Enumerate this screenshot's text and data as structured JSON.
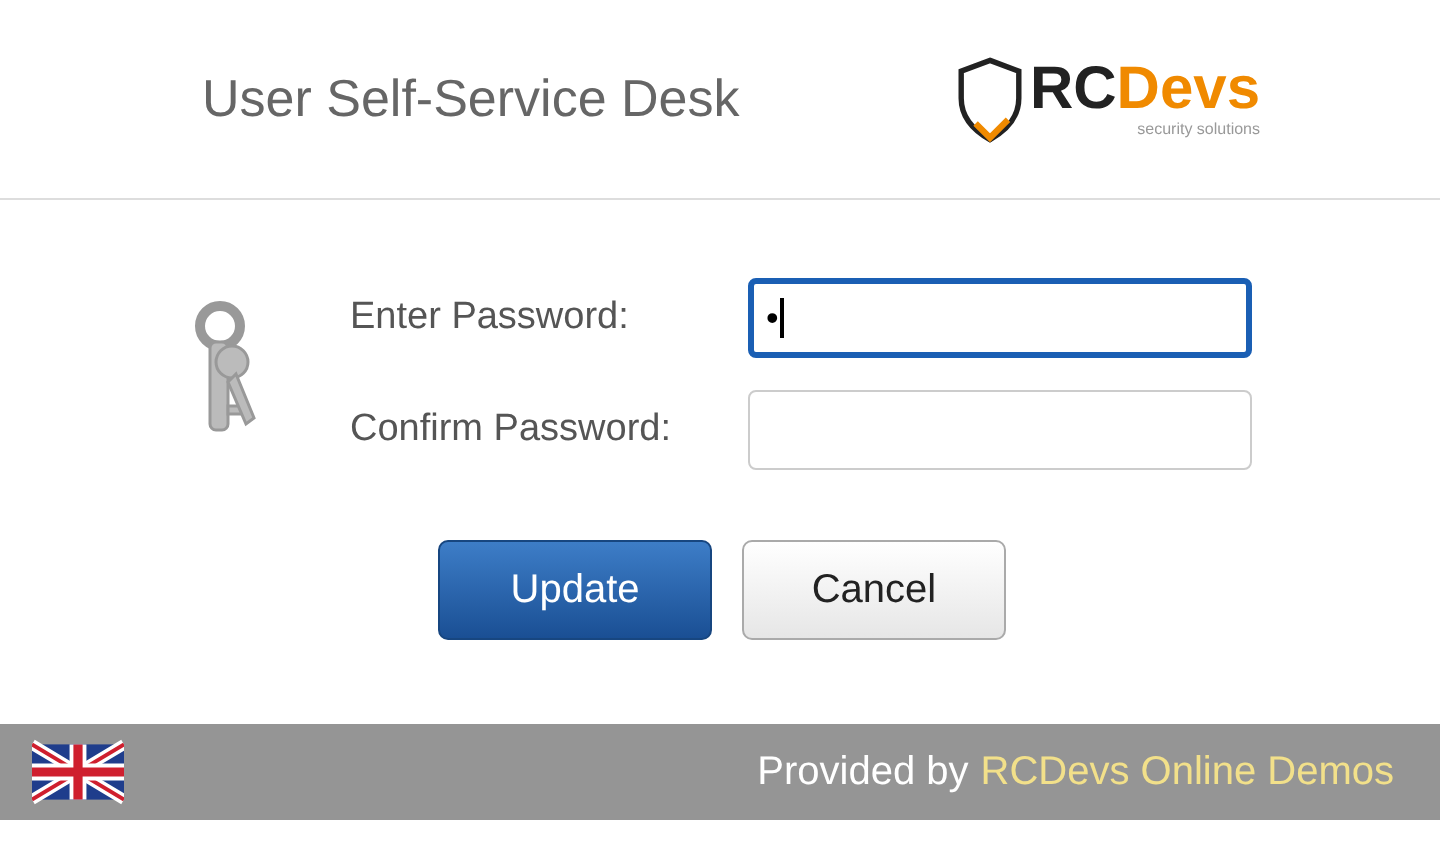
{
  "header": {
    "title": "User Self-Service Desk",
    "logo": {
      "part_1": "RC",
      "part_2": "Devs",
      "tagline": "security solutions"
    }
  },
  "form": {
    "fields": [
      {
        "label": "Enter Password:",
        "value": "•",
        "focused": true
      },
      {
        "label": "Confirm Password:",
        "focused": false
      }
    ],
    "buttons": [
      {
        "label": "Update",
        "kind": "primary"
      },
      {
        "label": "Cancel",
        "kind": "secondary"
      }
    ]
  },
  "footer": {
    "text": "Provided by",
    "link": "RCDevs Online Demos"
  }
}
